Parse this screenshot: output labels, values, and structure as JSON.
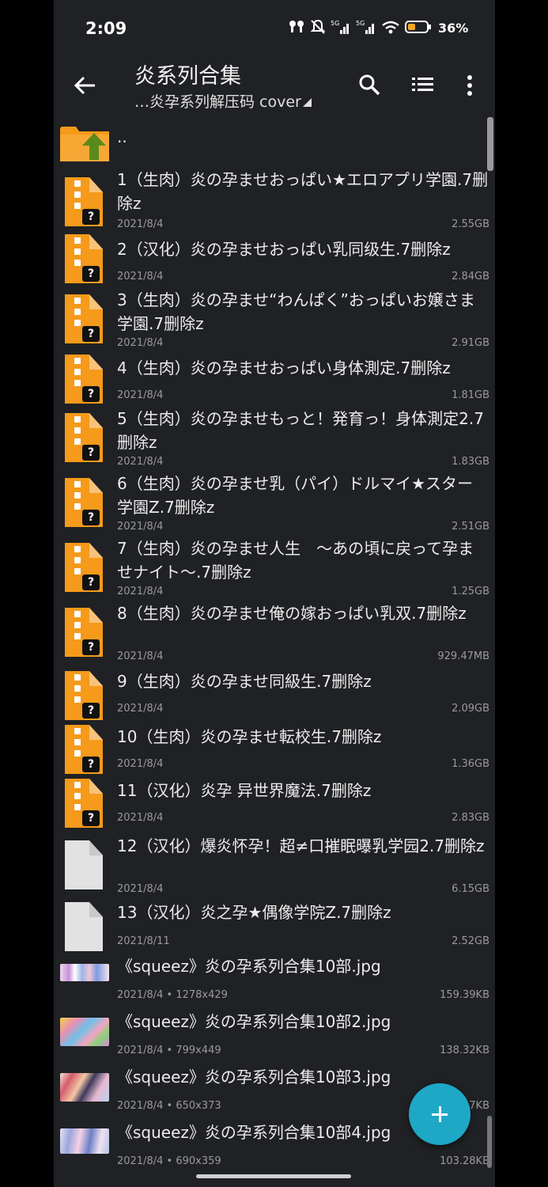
{
  "status_bar": {
    "time": "2:09",
    "network": "5G 5G",
    "battery": "36%"
  },
  "toolbar": {
    "title": "炎系列合集",
    "subtitle": "…炎孕系列解压码 cover"
  },
  "parent_entry": {
    "label": ".."
  },
  "files": [
    {
      "icon": "zip-file-icon",
      "name": "1（生肉）炎の孕ませおっぱい★エロアプリ学園.7删除z",
      "date": "2021/8/4",
      "size": "2.55GB"
    },
    {
      "icon": "zip-file-icon",
      "name": "2（汉化）炎の孕ませおっぱい乳同级生.7删除z",
      "date": "2021/8/4",
      "size": "2.84GB"
    },
    {
      "icon": "zip-file-icon",
      "name": "3（生肉）炎の孕ませ“わんぱく”おっぱいお嬢さま学園.7删除z",
      "date": "2021/8/4",
      "size": "2.91GB"
    },
    {
      "icon": "zip-file-icon",
      "name": "4（生肉）炎の孕ませおっぱい身体測定.7删除z",
      "date": "2021/8/4",
      "size": "1.81GB"
    },
    {
      "icon": "zip-file-icon",
      "name": "5（生肉）炎の孕ませもっと！発育っ！身体測定2.7删除z",
      "date": "2021/8/4",
      "size": "1.83GB"
    },
    {
      "icon": "zip-file-icon",
      "name": "6（生肉）炎の孕ませ乳（パイ）ドルマイ★スター学園Z.7删除z",
      "date": "2021/8/4",
      "size": "2.51GB"
    },
    {
      "icon": "zip-file-icon",
      "name": "7（生肉）炎の孕ませ人生　～あの頃に戻って孕ませナイト～.7删除z",
      "date": "2021/8/4",
      "size": "1.25GB"
    },
    {
      "icon": "zip-file-icon",
      "name": "8（生肉）炎の孕ませ俺の嫁おっぱい乳双.7删除z",
      "date": "2021/8/4",
      "size": "929.47MB"
    },
    {
      "icon": "zip-file-icon",
      "name": "9（生肉）炎の孕ませ同級生.7删除z",
      "date": "2021/8/4",
      "size": "2.09GB"
    },
    {
      "icon": "zip-file-icon",
      "name": "10（生肉）炎の孕ませ転校生.7删除z",
      "date": "2021/8/4",
      "size": "1.36GB"
    },
    {
      "icon": "zip-file-icon",
      "name": "11（汉化）炎孕 异世界魔法.7删除z",
      "date": "2021/8/4",
      "size": "2.83GB"
    },
    {
      "icon": "file-icon",
      "name": "12（汉化）爆炎怀孕！超≠口摧眠曝乳学园2.7删除z",
      "date": "2021/8/4",
      "size": "6.15GB"
    },
    {
      "icon": "file-icon",
      "name": "13（汉化）炎之孕★偶像学院Z.7删除z",
      "date": "2021/8/11",
      "size": "2.52GB"
    },
    {
      "icon": "image-thumbnail",
      "name": "《squeez》炎の孕系列合集10部.jpg",
      "date": "2021/8/4",
      "dims": "1278x429",
      "size": "159.39KB"
    },
    {
      "icon": "image-thumbnail",
      "name": "《squeez》炎の孕系列合集10部2.jpg",
      "date": "2021/8/4",
      "dims": "799x449",
      "size": "138.32KB"
    },
    {
      "icon": "image-thumbnail",
      "name": "《squeez》炎の孕系列合集10部3.jpg",
      "date": "2021/8/4",
      "dims": "650x373",
      "size": "7KB"
    },
    {
      "icon": "image-thumbnail",
      "name": "《squeez》炎の孕系列合集10部4.jpg",
      "date": "2021/8/4",
      "dims": "690x359",
      "size": "103.28KB"
    }
  ],
  "colors": {
    "background": "#202124",
    "accent": "#1ea8c6",
    "zip_orange": "#f59a1a"
  }
}
